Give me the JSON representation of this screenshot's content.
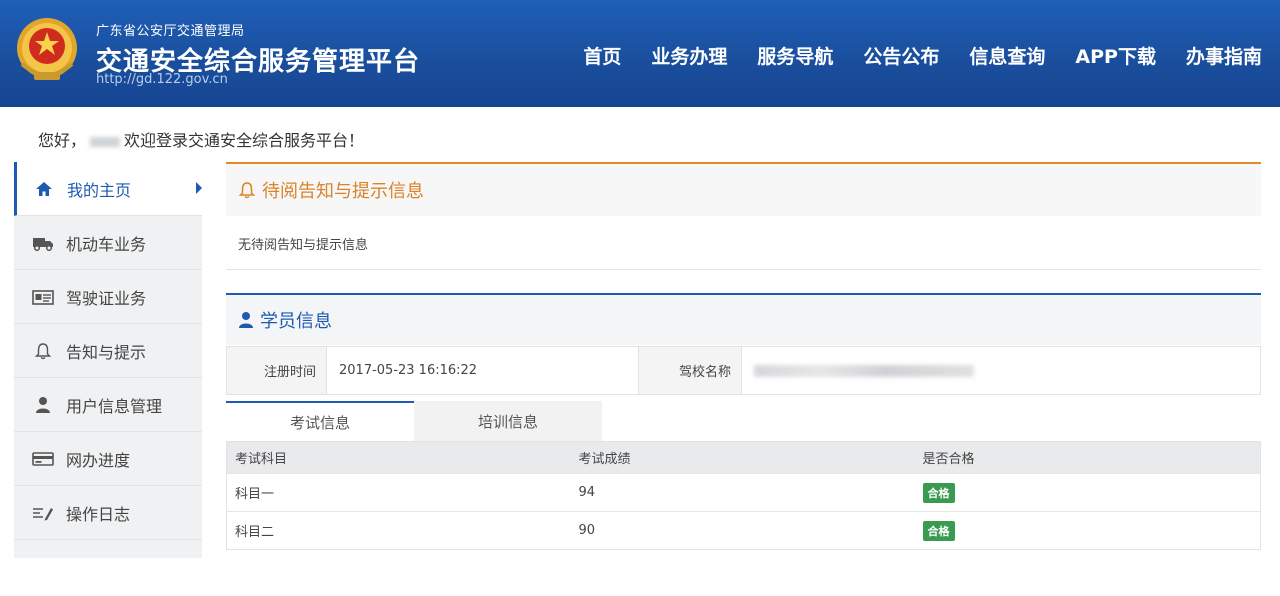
{
  "header": {
    "org_name": "广东省公安厅交通管理局",
    "site_title": "交通安全综合服务管理平台",
    "site_url": "http://gd.122.gov.cn",
    "nav": [
      "首页",
      "业务办理",
      "服务导航",
      "公告公布",
      "信息查询",
      "APP下载",
      "办事指南"
    ]
  },
  "welcome": {
    "prefix": "您好，",
    "suffix": "欢迎登录交通安全综合服务平台！"
  },
  "sidebar": {
    "items": [
      {
        "label": "我的主页",
        "icon": "home-icon"
      },
      {
        "label": "机动车业务",
        "icon": "truck-icon"
      },
      {
        "label": "驾驶证业务",
        "icon": "license-card-icon"
      },
      {
        "label": "告知与提示",
        "icon": "bell-icon"
      },
      {
        "label": "用户信息管理",
        "icon": "user-icon"
      },
      {
        "label": "网办进度",
        "icon": "credit-card-icon"
      },
      {
        "label": "操作日志",
        "icon": "log-icon"
      }
    ]
  },
  "notice": {
    "title": "待阅告知与提示信息",
    "body": "无待阅告知与提示信息"
  },
  "student": {
    "title": "学员信息",
    "reg_time_label": "注册时间",
    "reg_time_value": "2017-05-23 16:16:22",
    "school_label": "驾校名称"
  },
  "tabs": [
    "考试信息",
    "培训信息"
  ],
  "exam_table": {
    "headers": [
      "考试科目",
      "考试成绩",
      "是否合格"
    ],
    "rows": [
      {
        "subject": "科目一",
        "score": "94",
        "result": "合格"
      },
      {
        "subject": "科目二",
        "score": "90",
        "result": "合格"
      }
    ]
  },
  "colors": {
    "header_blue": "#1a4f9e",
    "accent_blue": "#1d5bb3",
    "notice_orange": "#e08a2b",
    "pass_green": "#3a9a4f"
  }
}
